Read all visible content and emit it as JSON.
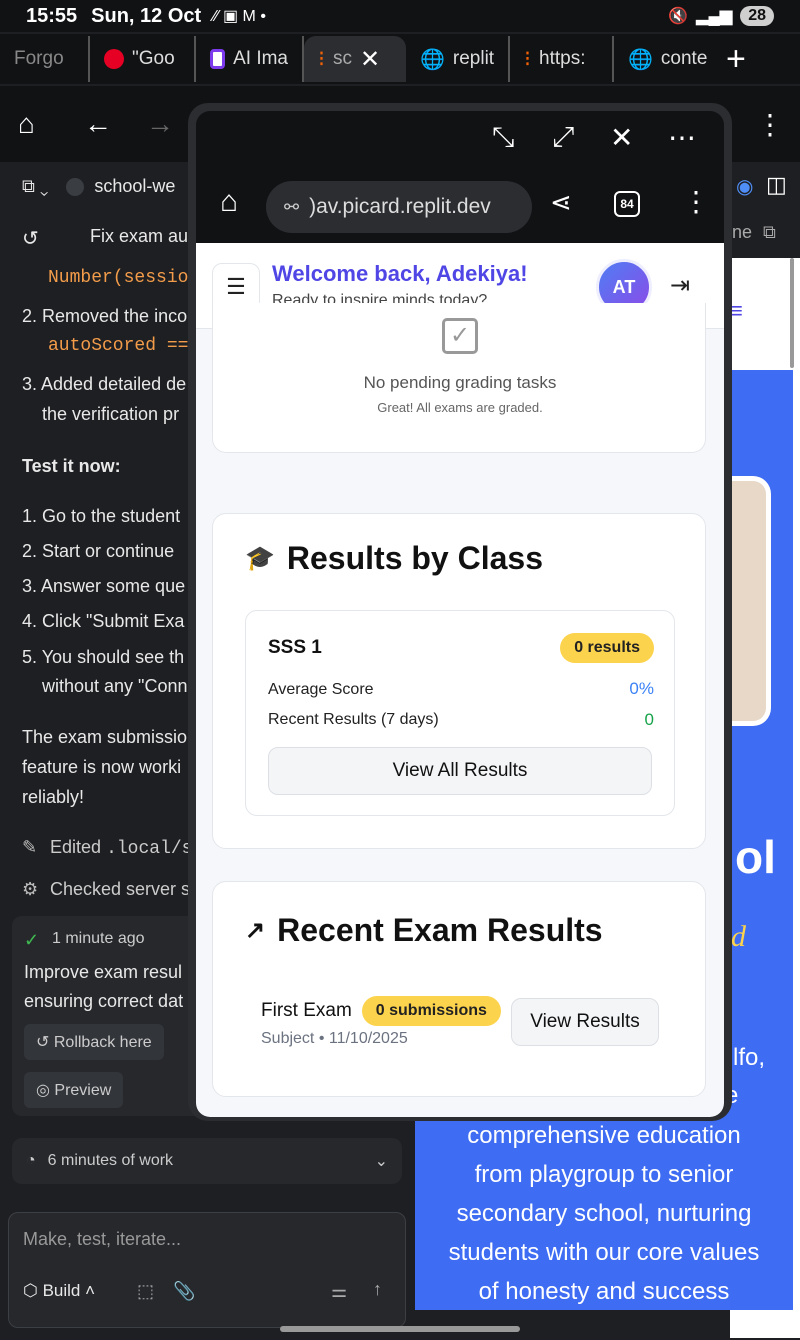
{
  "status_bar": {
    "time": "15:55",
    "date": "Sun, 12 Oct",
    "battery": "28"
  },
  "tabs": [
    {
      "label": "Forgo",
      "color": "#555555"
    },
    {
      "label": "\"Goo",
      "color": "#e60023"
    },
    {
      "label": "AI Ima",
      "color": "#ffffff"
    },
    {
      "label": "sc",
      "color": "#f26207"
    },
    {
      "label": "replit",
      "color": "#cccccc"
    },
    {
      "label": "https:",
      "color": "#f26207"
    },
    {
      "label": "conte",
      "color": "#cccccc"
    }
  ],
  "replit": {
    "project": "school-we",
    "task_title": "Fix exam au",
    "code1": "Number(session",
    "step2": "2. Removed the inco",
    "code2": "autoScored ===",
    "step3a": "3. Added detailed de",
    "step3b": "the verification pr",
    "test_heading": "Test it now:",
    "steps": [
      "1. Go to the student",
      "2. Start or continue",
      "3. Answer some que",
      "4. Click \"Submit Exa",
      "5. You should see th"
    ],
    "step5b": "without any \"Conn",
    "summary": [
      "The exam submissio",
      "feature is now worki",
      "reliably!"
    ],
    "edited_prefix": "Edited",
    "edited_path": ".local/s",
    "checked": "Checked server s",
    "checkpoint_time": "1 minute ago",
    "checkpoint_text": [
      "Improve exam resul",
      "ensuring correct dat"
    ],
    "rollback": "Rollback here",
    "preview": "Preview",
    "work": "6 minutes of work",
    "placeholder": "Make, test, iterate...",
    "build": "Build"
  },
  "behind_page": {
    "ne_text": "ne",
    "title_fragment": "ol",
    "italic_fragment": "d",
    "desc_fragment1": "lfo,",
    "desc_fragment2": "e",
    "desc": [
      "comprehensive education",
      "from playgroup to senior",
      "secondary school, nurturing",
      "students with our core values",
      "of honesty and success"
    ]
  },
  "popup": {
    "url": ")av.picard.replit.dev",
    "tab_count": "84",
    "welcome": "Welcome back, Adekiya!",
    "tagline": "Ready to inspire minds today?",
    "avatar_initials": "AT",
    "grading": {
      "title": "No pending grading tasks",
      "subtitle": "Great! All exams are graded."
    },
    "results_by_class": {
      "title": "Results by Class",
      "class_name": "SSS 1",
      "badge": "0 results",
      "avg_label": "Average Score",
      "avg_value": "0%",
      "recent_label": "Recent Results (7 days)",
      "recent_value": "0",
      "button": "View All Results"
    },
    "recent_exam_results": {
      "title": "Recent Exam Results",
      "exam_name": "First Exam",
      "badge": "0 submissions",
      "meta": "Subject • 11/10/2025",
      "button": "View Results"
    }
  }
}
